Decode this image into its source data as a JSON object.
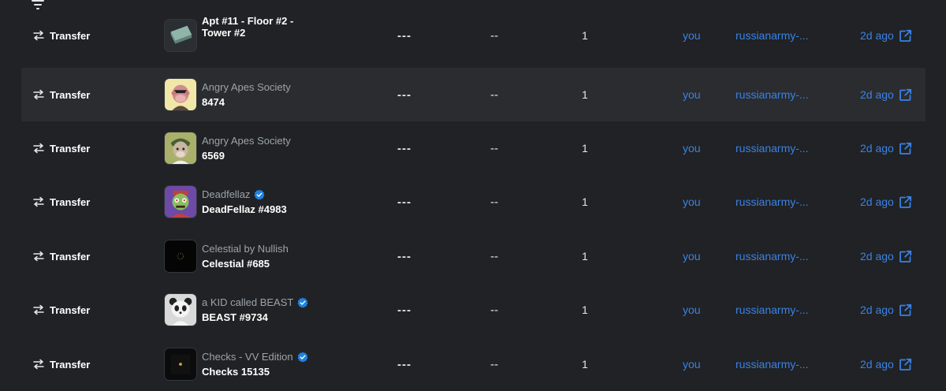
{
  "toolbar": {
    "filter_icon": "filter-lines-icon"
  },
  "colors": {
    "link": "#3a82e6",
    "background": "#202225",
    "highlight_row": "#2a2c30",
    "verified": "#2081e2"
  },
  "rows": [
    {
      "event": "Transfer",
      "event_icon": "arrows-transfer-icon",
      "collection": "",
      "verified": true,
      "item": "Apt #11 - Floor #2 -",
      "item_line2": "Tower #2",
      "price": "---",
      "usd": "--",
      "quantity": "1",
      "from": "you",
      "to": "russianarmy-...",
      "time": "2d ago",
      "thumb": "tower"
    },
    {
      "event": "Transfer",
      "event_icon": "arrows-transfer-icon",
      "collection": "Angry Apes Society",
      "verified": false,
      "item": "8474",
      "item_line2": "",
      "price": "---",
      "usd": "--",
      "quantity": "1",
      "from": "you",
      "to": "russianarmy-...",
      "time": "2d ago",
      "thumb": "ape-yellow"
    },
    {
      "event": "Transfer",
      "event_icon": "arrows-transfer-icon",
      "collection": "Angry Apes Society",
      "verified": false,
      "item": "6569",
      "item_line2": "",
      "price": "---",
      "usd": "--",
      "quantity": "1",
      "from": "you",
      "to": "russianarmy-...",
      "time": "2d ago",
      "thumb": "ape-green"
    },
    {
      "event": "Transfer",
      "event_icon": "arrows-transfer-icon",
      "collection": "Deadfellaz",
      "verified": true,
      "item": "DeadFellaz #4983",
      "item_line2": "",
      "price": "---",
      "usd": "--",
      "quantity": "1",
      "from": "you",
      "to": "russianarmy-...",
      "time": "2d ago",
      "thumb": "zombie"
    },
    {
      "event": "Transfer",
      "event_icon": "arrows-transfer-icon",
      "collection": "Celestial by Nullish",
      "verified": false,
      "item": "Celestial #685",
      "item_line2": "",
      "price": "---",
      "usd": "--",
      "quantity": "1",
      "from": "you",
      "to": "russianarmy-...",
      "time": "2d ago",
      "thumb": "celestial"
    },
    {
      "event": "Transfer",
      "event_icon": "arrows-transfer-icon",
      "collection": "a KID called BEAST",
      "verified": true,
      "item": "BEAST #9734",
      "item_line2": "",
      "price": "---",
      "usd": "--",
      "quantity": "1",
      "from": "you",
      "to": "russianarmy-...",
      "time": "2d ago",
      "thumb": "panda"
    },
    {
      "event": "Transfer",
      "event_icon": "arrows-transfer-icon",
      "collection": "Checks - VV Edition",
      "verified": true,
      "item": "Checks 15135",
      "item_line2": "",
      "price": "---",
      "usd": "--",
      "quantity": "1",
      "from": "you",
      "to": "russianarmy-...",
      "time": "2d ago",
      "thumb": "checks"
    }
  ]
}
